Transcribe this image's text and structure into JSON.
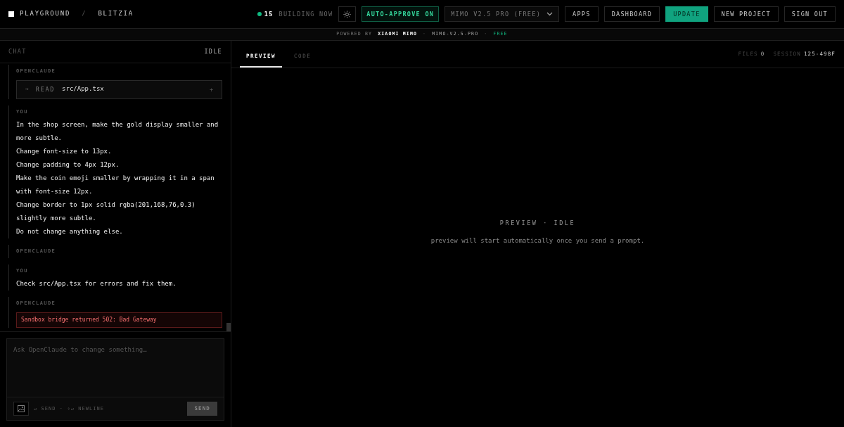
{
  "brand": {
    "name": "PLAYGROUND",
    "separator": "/",
    "project": "BLITZIA"
  },
  "status": {
    "count": "15",
    "label": "BUILDING NOW"
  },
  "auto_approve": {
    "label": "AUTO-APPROVE ON",
    "on": true
  },
  "model_select": {
    "value": "MIMO V2.5 PRO (FREE)"
  },
  "nav_buttons": [
    {
      "label": "APPS",
      "kind": "plain"
    },
    {
      "label": "DASHBOARD",
      "kind": "plain"
    },
    {
      "label": "UPDATE",
      "kind": "primary"
    },
    {
      "label": "NEW PROJECT",
      "kind": "plain"
    },
    {
      "label": "SIGN OUT",
      "kind": "plain"
    }
  ],
  "powered_by": {
    "separator": "·",
    "prefix": "POWERED BY",
    "provider": "XIAOMI MIMO",
    "model": "MIMO-V2.5-PRO",
    "tier": "FREE"
  },
  "chat": {
    "title": "CHAT",
    "state": "IDLE",
    "messages": [
      {
        "author": "OPENCLAUDE",
        "kind": "tool",
        "arrow": "→",
        "verb": "READ",
        "path": "src/App.tsx",
        "toggle": "+"
      },
      {
        "author": "YOU",
        "kind": "text",
        "lines": [
          "In the shop screen, make the gold display smaller and more subtle.",
          "Change font-size to 13px.",
          "Change padding to 4px 12px.",
          "Make the coin emoji smaller by wrapping it in a span with font-size 12px.",
          "Change border to 1px solid rgba(201,168,76,0.3) slightly more subtle.",
          "Do not change anything else."
        ]
      },
      {
        "author": "OPENCLAUDE",
        "kind": "empty"
      },
      {
        "author": "YOU",
        "kind": "text",
        "lines": [
          "Check src/App.tsx for errors and fix them."
        ]
      },
      {
        "author": "OPENCLAUDE",
        "kind": "error",
        "text": "Sandbox bridge returned 502: Bad Gateway"
      }
    ],
    "composer": {
      "placeholder": "Ask OpenClaude to change something…",
      "hint": "↵ SEND · ⇧↵ NEWLINE",
      "send": "SEND",
      "send_disabled": true
    }
  },
  "tabs": [
    {
      "label": "PREVIEW",
      "selected": true
    },
    {
      "label": "CODE",
      "selected": false
    }
  ],
  "meta": {
    "files_label": "FILES",
    "files": "0",
    "session_label": "SESSION",
    "session": "125-498F"
  },
  "preview": {
    "title": "PREVIEW · IDLE",
    "message": "preview will start automatically once you send a prompt."
  }
}
